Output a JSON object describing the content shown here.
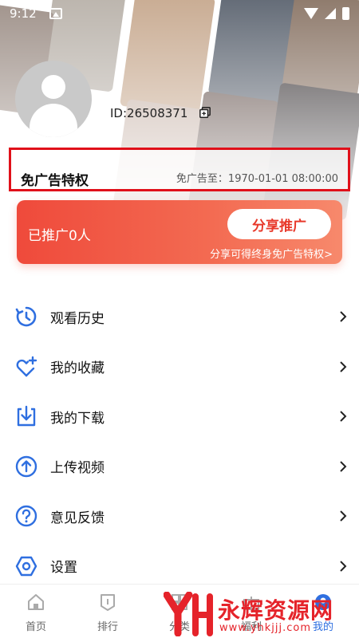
{
  "status_bar": {
    "time": "9:12"
  },
  "profile": {
    "user_id": "ID:26508371"
  },
  "privilege": {
    "title": "免广告特权",
    "expire_text": "免广告至：1970-01-01 08:00:00"
  },
  "promo": {
    "count_text": "已推广0人",
    "button_label": "分享推广",
    "hint_text": "分享可得终身免广告特权>"
  },
  "menu": {
    "items": [
      {
        "label": "观看历史",
        "icon": "history-icon"
      },
      {
        "label": "我的收藏",
        "icon": "heart-plus-icon"
      },
      {
        "label": "我的下载",
        "icon": "download-icon"
      },
      {
        "label": "上传视频",
        "icon": "upload-icon"
      },
      {
        "label": "意见反馈",
        "icon": "help-icon"
      },
      {
        "label": "设置",
        "icon": "settings-icon"
      }
    ]
  },
  "bottom_nav": {
    "items": [
      {
        "label": "首页"
      },
      {
        "label": "排行"
      },
      {
        "label": "分类"
      },
      {
        "label": "福利"
      },
      {
        "label": "我的"
      }
    ]
  },
  "watermark": {
    "title": "永辉资源网",
    "url": "www.yhkjjj.com"
  },
  "colors": {
    "accent": "#2f6fe0",
    "promo_start": "#ef4a3b",
    "promo_end": "#f7896c",
    "highlight_border": "#e0101a"
  }
}
